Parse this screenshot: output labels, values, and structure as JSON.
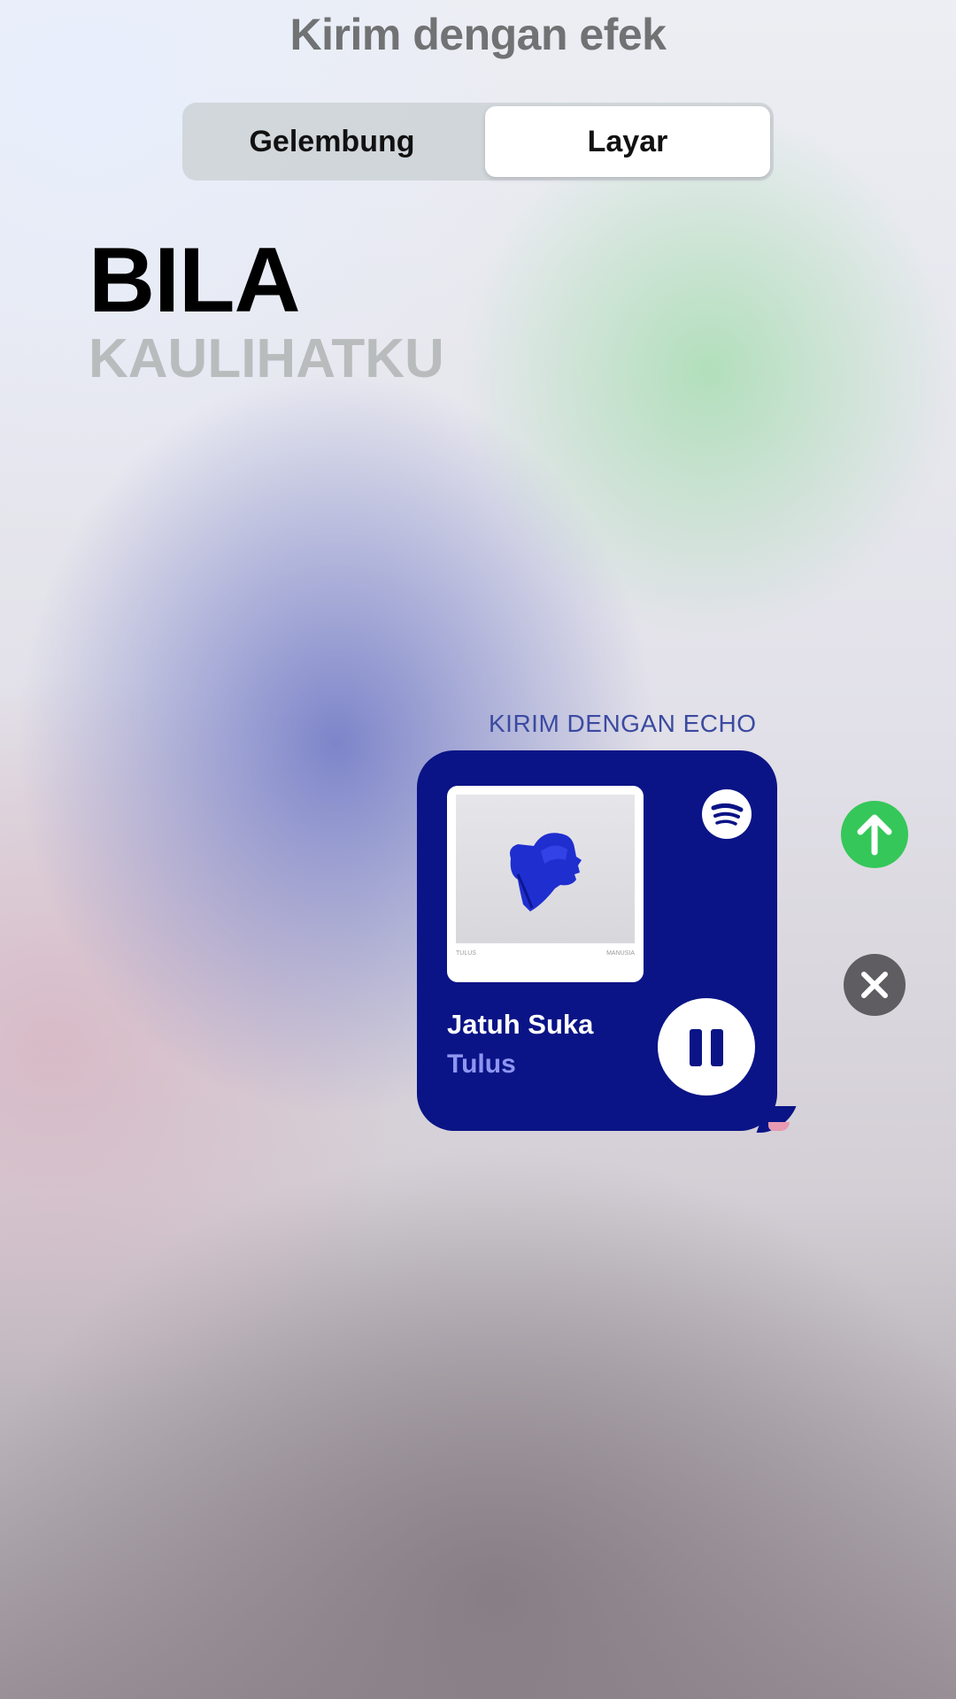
{
  "header": {
    "title": "Kirim dengan efek"
  },
  "effect_tabs": {
    "items": [
      {
        "label": "Gelembung",
        "selected": false
      },
      {
        "label": "Layar",
        "selected": true
      }
    ]
  },
  "lyrics": {
    "line1": "BILA",
    "line2": "KAULIHATKU"
  },
  "echo": {
    "label": "KIRIM DENGAN ECHO"
  },
  "music_card": {
    "track_title": "Jatuh Suka",
    "artist": "Tulus",
    "album_footer_left": "TULUS",
    "album_footer_right": "MANUSIA",
    "service_icon": "spotify-icon",
    "control_icon": "pause-icon",
    "card_color": "#0a1486",
    "artist_color": "#8f96f0"
  },
  "actions": {
    "send_icon": "arrow-up-icon",
    "send_color": "#35c759",
    "cancel_icon": "close-icon",
    "cancel_color": "#5f5d61"
  }
}
